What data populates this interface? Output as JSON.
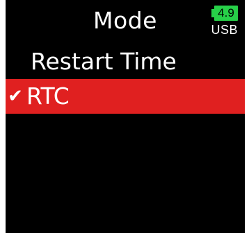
{
  "header": {
    "title": "Mode",
    "battery": {
      "level": "4.9",
      "source": "USB",
      "color": "#27d048"
    }
  },
  "menu": {
    "items": [
      {
        "label": "Restart Time",
        "selected": false
      },
      {
        "label": "RTC",
        "selected": true,
        "check": "✔"
      }
    ],
    "highlight_color": "#e02020"
  }
}
